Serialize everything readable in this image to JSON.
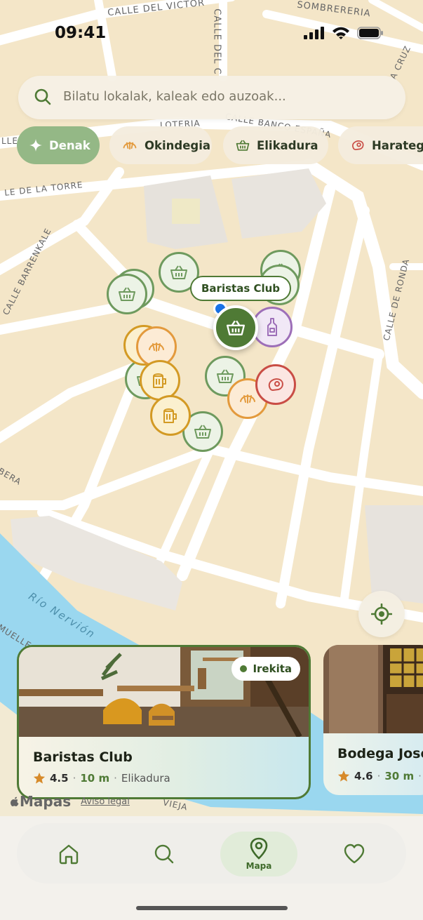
{
  "status": {
    "time": "09:41"
  },
  "search": {
    "placeholder": "Bilatu lokalak, kaleak edo auzoak..."
  },
  "chips": [
    {
      "label": "Denak",
      "icon": "sparkle-icon",
      "active": true
    },
    {
      "label": "Okindegia",
      "icon": "croissant-icon"
    },
    {
      "label": "Elikadura",
      "icon": "basket-icon"
    },
    {
      "label": "Harategi",
      "icon": "meat-icon"
    }
  ],
  "map": {
    "street_labels": [
      "CALLE DEL VICTOR",
      "SOMBRERERIA",
      "CALLE DEL C",
      "LOTERIA",
      "CALLE BANCO ESPAÑA",
      "LLE",
      "LE DE LA TORRE",
      "CALLE BARRENKALE",
      "CALLE DE RONDA",
      "A CRUZ",
      "BERA",
      "Río Nervión",
      "MUELLE",
      "VIEJA"
    ],
    "callout": "Baristas Club"
  },
  "colors": {
    "accent": "#4f7a35",
    "chip_active": "#94b886",
    "elikadura": "#6e9a5e",
    "okindegia": "#d39a24",
    "harategia": "#c94d45",
    "edari": "#9d6fb8"
  },
  "cards": [
    {
      "name": "Baristas Club",
      "status": "Irekita",
      "rating": "4.5",
      "distance": "10 m",
      "category": "Elikadura"
    },
    {
      "name": "Bodega Jose",
      "rating": "4.6",
      "distance": "30 m",
      "category": "·"
    }
  ],
  "legal": {
    "brand": "Mapas",
    "link": "Aviso legal"
  },
  "tabs": [
    {
      "icon": "home-icon",
      "label": ""
    },
    {
      "icon": "search-icon",
      "label": ""
    },
    {
      "icon": "map-pin-icon",
      "label": "Mapa",
      "active": true
    },
    {
      "icon": "heart-icon",
      "label": ""
    }
  ]
}
